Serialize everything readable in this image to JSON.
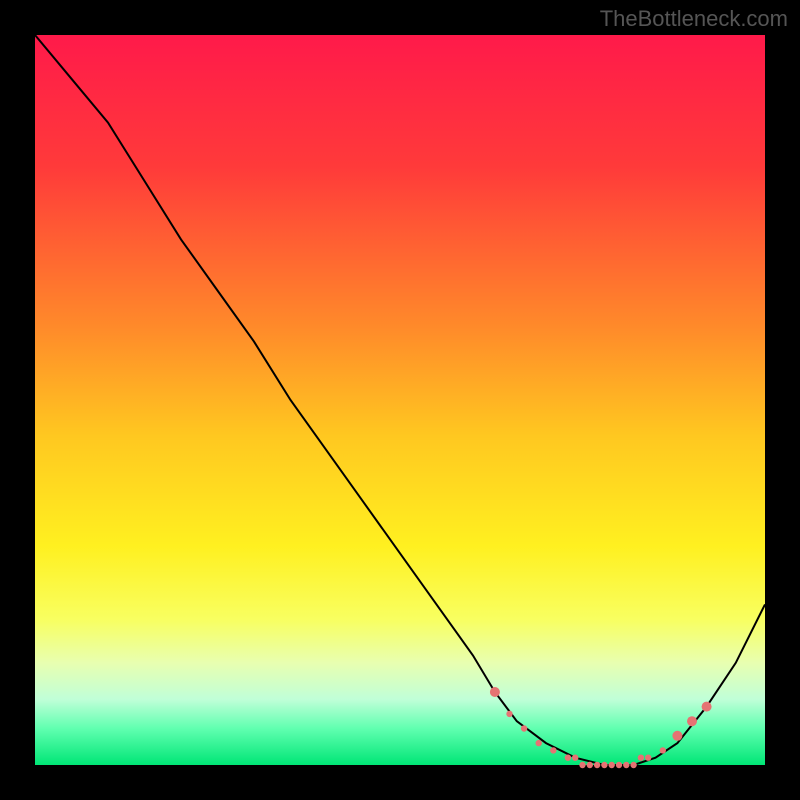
{
  "watermark": "TheBottleneck.com",
  "chart_data": {
    "type": "line",
    "title": "",
    "xlabel": "",
    "ylabel": "",
    "xlim": [
      0,
      100
    ],
    "ylim": [
      0,
      100
    ],
    "gradient_stops": [
      {
        "offset": 0,
        "color": "#ff1a4a"
      },
      {
        "offset": 18,
        "color": "#ff3a3a"
      },
      {
        "offset": 40,
        "color": "#ff8a2a"
      },
      {
        "offset": 55,
        "color": "#ffc820"
      },
      {
        "offset": 70,
        "color": "#fff020"
      },
      {
        "offset": 80,
        "color": "#f8ff60"
      },
      {
        "offset": 86,
        "color": "#e8ffb0"
      },
      {
        "offset": 91,
        "color": "#c0ffd8"
      },
      {
        "offset": 95,
        "color": "#60ffb0"
      },
      {
        "offset": 100,
        "color": "#00e676"
      }
    ],
    "series": [
      {
        "name": "bottleneck-curve",
        "color": "#000000",
        "x": [
          0,
          5,
          10,
          15,
          20,
          25,
          30,
          35,
          40,
          45,
          50,
          55,
          60,
          63,
          66,
          70,
          74,
          78,
          82,
          85,
          88,
          92,
          96,
          100
        ],
        "y": [
          100,
          94,
          88,
          80,
          72,
          65,
          58,
          50,
          43,
          36,
          29,
          22,
          15,
          10,
          6,
          3,
          1,
          0,
          0,
          1,
          3,
          8,
          14,
          22
        ]
      }
    ],
    "markers": {
      "name": "highlight-dots",
      "color": "#e57373",
      "radius_small": 3.2,
      "radius_large": 5.0,
      "points": [
        {
          "x": 63,
          "y": 10,
          "size": "large"
        },
        {
          "x": 65,
          "y": 7,
          "size": "small"
        },
        {
          "x": 67,
          "y": 5,
          "size": "small"
        },
        {
          "x": 69,
          "y": 3,
          "size": "small"
        },
        {
          "x": 71,
          "y": 2,
          "size": "small"
        },
        {
          "x": 73,
          "y": 1,
          "size": "small"
        },
        {
          "x": 74,
          "y": 1,
          "size": "small"
        },
        {
          "x": 75,
          "y": 0,
          "size": "small"
        },
        {
          "x": 76,
          "y": 0,
          "size": "small"
        },
        {
          "x": 77,
          "y": 0,
          "size": "small"
        },
        {
          "x": 78,
          "y": 0,
          "size": "small"
        },
        {
          "x": 79,
          "y": 0,
          "size": "small"
        },
        {
          "x": 80,
          "y": 0,
          "size": "small"
        },
        {
          "x": 81,
          "y": 0,
          "size": "small"
        },
        {
          "x": 82,
          "y": 0,
          "size": "small"
        },
        {
          "x": 83,
          "y": 1,
          "size": "small"
        },
        {
          "x": 84,
          "y": 1,
          "size": "small"
        },
        {
          "x": 86,
          "y": 2,
          "size": "small"
        },
        {
          "x": 88,
          "y": 4,
          "size": "large"
        },
        {
          "x": 90,
          "y": 6,
          "size": "large"
        },
        {
          "x": 92,
          "y": 8,
          "size": "large"
        }
      ]
    }
  }
}
